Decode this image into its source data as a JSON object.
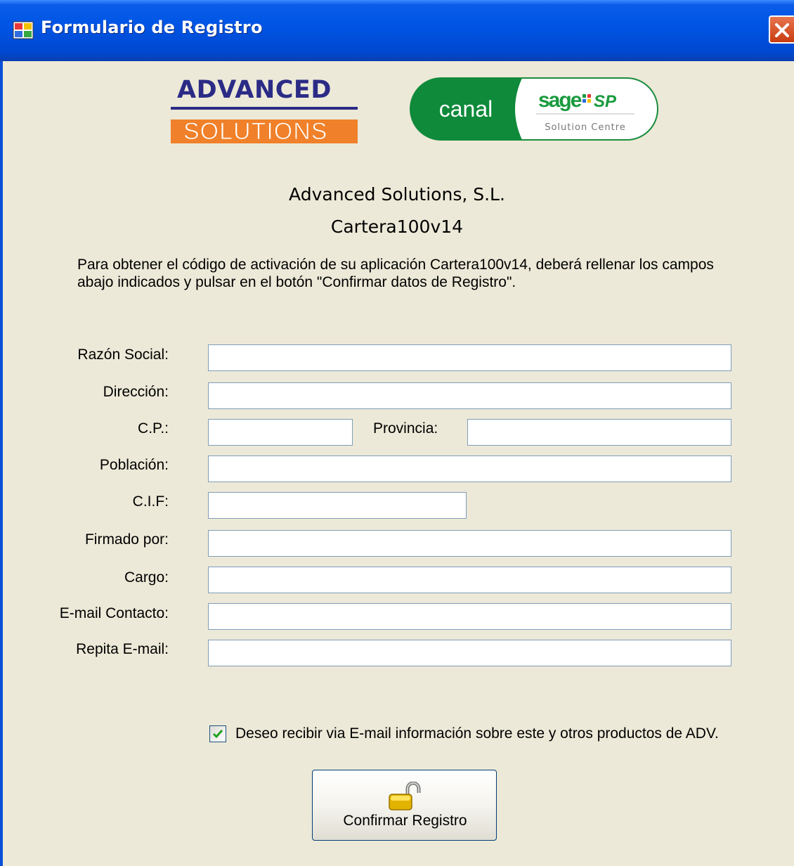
{
  "window": {
    "title": "Formulario de Registro",
    "close_icon": "close-icon"
  },
  "logos": {
    "advanced_top": "ADVANCED",
    "advanced_bottom": "SOLUTIONS",
    "canal": "canal",
    "sage": "sage",
    "sp": "SP",
    "solution_centre": "Solution Centre"
  },
  "header": {
    "company": "Advanced Solutions, S.L.",
    "product": "Cartera100v14"
  },
  "intro": {
    "line1": "Para obtener el código de activación de su aplicación Cartera100v14, deberá rellenar los campos",
    "line2": "abajo indicados y pulsar en el botón \"Confirmar datos de Registro\"."
  },
  "form": {
    "razon_social": {
      "label": "Razón Social:",
      "value": ""
    },
    "direccion": {
      "label": "Dirección:",
      "value": ""
    },
    "cp": {
      "label": "C.P.:",
      "value": ""
    },
    "provincia": {
      "label": "Provincia:",
      "value": ""
    },
    "poblacion": {
      "label": "Población:",
      "value": ""
    },
    "cif": {
      "label": "C.I.F:",
      "value": ""
    },
    "firmado_por": {
      "label": "Firmado por:",
      "value": ""
    },
    "cargo": {
      "label": "Cargo:",
      "value": ""
    },
    "email": {
      "label": "E-mail Contacto:",
      "value": ""
    },
    "repita_email": {
      "label": "Repita E-mail:",
      "value": ""
    }
  },
  "newsletter": {
    "checked": true,
    "label": "Deseo recibir via E-mail información sobre este y otros productos de ADV."
  },
  "confirm_button": {
    "label": "Confirmar Registro",
    "icon": "unlocked-padlock-icon"
  },
  "colors": {
    "titlebar": "#0055e5",
    "window_bg": "#ece9d8",
    "input_border": "#7f9db9",
    "advanced_blue": "#2b2b86",
    "solutions_orange": "#f0812a",
    "canal_green": "#0e8a3a"
  }
}
